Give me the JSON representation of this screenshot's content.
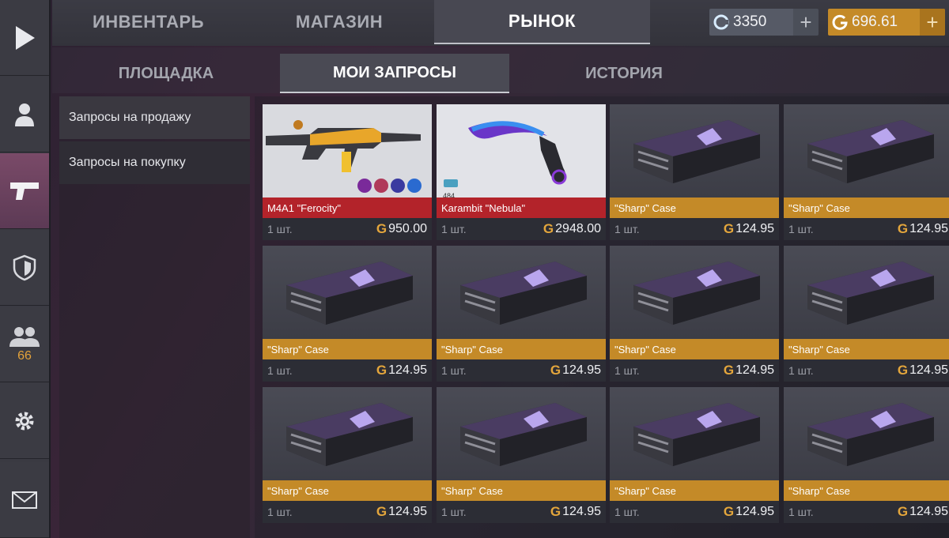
{
  "sidebar": {
    "items": [
      {
        "name": "play"
      },
      {
        "name": "profile"
      },
      {
        "name": "weapons",
        "active": true
      },
      {
        "name": "clan"
      },
      {
        "name": "friends",
        "count": "66"
      },
      {
        "name": "settings"
      },
      {
        "name": "mail"
      }
    ]
  },
  "topnav": {
    "tabs": [
      {
        "label": "ИНВЕНТАРЬ"
      },
      {
        "label": "МАГАЗИН"
      },
      {
        "label": "РЫНОК",
        "active": true
      }
    ],
    "silver": "3350",
    "gold": "696.61",
    "colors": {
      "silver": "#565a66",
      "gold": "#c48a28"
    }
  },
  "subnav": {
    "tabs": [
      {
        "label": "ПЛОЩАДКА"
      },
      {
        "label": "МОИ ЗАПРОСЫ",
        "active": true
      },
      {
        "label": "ИСТОРИЯ"
      }
    ]
  },
  "filters": {
    "items": [
      {
        "label": "Запросы на продажу"
      },
      {
        "label": "Запросы на покупку"
      }
    ]
  },
  "badge_count": "484",
  "cards": [
    {
      "name": "M4A1 \"Ferocity\"",
      "qty": "1 шт.",
      "price": "950.00",
      "rarity": "red",
      "kind": "rifle"
    },
    {
      "name": "Karambit \"Nebula\"",
      "qty": "1 шт.",
      "price": "2948.00",
      "rarity": "red",
      "kind": "knife"
    },
    {
      "name": "\"Sharp\" Case",
      "qty": "1 шт.",
      "price": "124.95",
      "rarity": "gold",
      "kind": "case"
    },
    {
      "name": "\"Sharp\" Case",
      "qty": "1 шт.",
      "price": "124.95",
      "rarity": "gold",
      "kind": "case"
    },
    {
      "name": "\"Sharp\" Case",
      "qty": "1 шт.",
      "price": "124.95",
      "rarity": "gold",
      "kind": "case"
    },
    {
      "name": "\"Sharp\" Case",
      "qty": "1 шт.",
      "price": "124.95",
      "rarity": "gold",
      "kind": "case"
    },
    {
      "name": "\"Sharp\" Case",
      "qty": "1 шт.",
      "price": "124.95",
      "rarity": "gold",
      "kind": "case"
    },
    {
      "name": "\"Sharp\" Case",
      "qty": "1 шт.",
      "price": "124.95",
      "rarity": "gold",
      "kind": "case"
    },
    {
      "name": "\"Sharp\" Case",
      "qty": "1 шт.",
      "price": "124.95",
      "rarity": "gold",
      "kind": "case"
    },
    {
      "name": "\"Sharp\" Case",
      "qty": "1 шт.",
      "price": "124.95",
      "rarity": "gold",
      "kind": "case"
    },
    {
      "name": "\"Sharp\" Case",
      "qty": "1 шт.",
      "price": "124.95",
      "rarity": "gold",
      "kind": "case"
    },
    {
      "name": "\"Sharp\" Case",
      "qty": "1 шт.",
      "price": "124.95",
      "rarity": "gold",
      "kind": "case"
    }
  ],
  "currency_symbol": "G"
}
